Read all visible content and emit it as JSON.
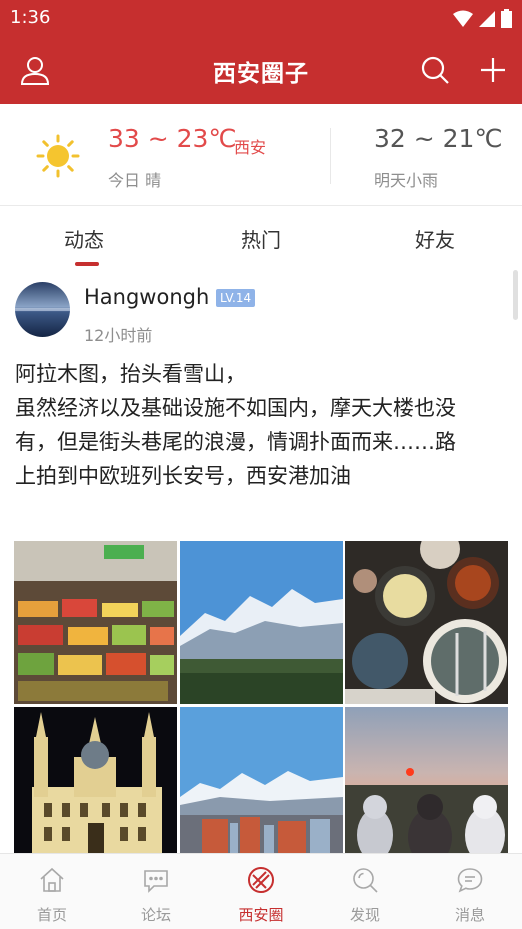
{
  "status_bar": {
    "time": "1:36"
  },
  "app_bar": {
    "title": "西安圈子"
  },
  "weather": {
    "today_temp": "33 ~ 23℃",
    "today_city": "西安",
    "today_desc": "今日 晴",
    "tomorrow_temp": "32 ~ 21℃",
    "tomorrow_desc": "明天小雨"
  },
  "tabs": [
    {
      "label": "动态",
      "active": true
    },
    {
      "label": "热门",
      "active": false
    },
    {
      "label": "好友",
      "active": false
    }
  ],
  "post": {
    "username": "Hangwongh",
    "level": "LV.14",
    "time": "12小时前",
    "lines": [
      "阿拉木图，抬头看雪山，",
      "虽然经济以及基础设施不如国内，摩天大楼也没",
      "有，但是街头巷尾的浪漫，情调扑面而来……路",
      "上拍到中欧班列长安号，西安港加油"
    ],
    "photos": [
      "market-photo",
      "snow-mountain-photo",
      "food-photo",
      "cathedral-photo",
      "city-mountain-photo",
      "sunset-photo"
    ]
  },
  "bottom_nav": [
    {
      "label": "首页",
      "icon": "home-icon",
      "active": false
    },
    {
      "label": "论坛",
      "icon": "forum-icon",
      "active": false
    },
    {
      "label": "西安圈",
      "icon": "xian-circle-icon",
      "active": true
    },
    {
      "label": "发现",
      "icon": "discover-icon",
      "active": false
    },
    {
      "label": "消息",
      "icon": "message-icon",
      "active": false
    }
  ],
  "colors": {
    "brand": "#c62f2f",
    "hot_temp": "#e24a4a",
    "badge": "#8fb3e8"
  }
}
